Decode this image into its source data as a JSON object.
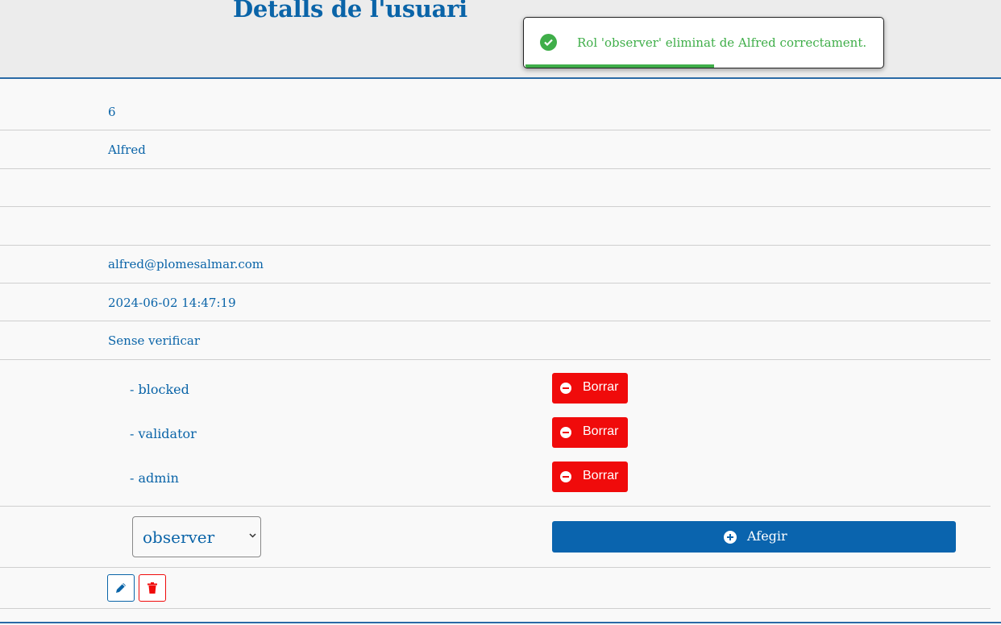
{
  "header": {
    "title": "Detalls de l'usuari"
  },
  "toast": {
    "message": "Rol 'observer' eliminat de Alfred correctament.",
    "icon": "check-circle-icon",
    "color": "#3fae49"
  },
  "user": {
    "id": "6",
    "name": "Alfred",
    "field3": "",
    "field4": "",
    "email": "alfred@plomesalmar.com",
    "created": "2024-06-02 14:47:19",
    "status": "Sense verificar"
  },
  "roles": [
    {
      "label": "- blocked",
      "button": "Borrar"
    },
    {
      "label": "- validator",
      "button": "Borrar"
    },
    {
      "label": "- admin",
      "button": "Borrar"
    }
  ],
  "add_role": {
    "selected": "observer",
    "button": "Afegir"
  },
  "actions": {
    "edit_icon": "pencil-icon",
    "delete_icon": "trash-icon"
  },
  "colors": {
    "primary": "#0a64a8",
    "danger": "#f00b0b",
    "success": "#3fae49"
  }
}
